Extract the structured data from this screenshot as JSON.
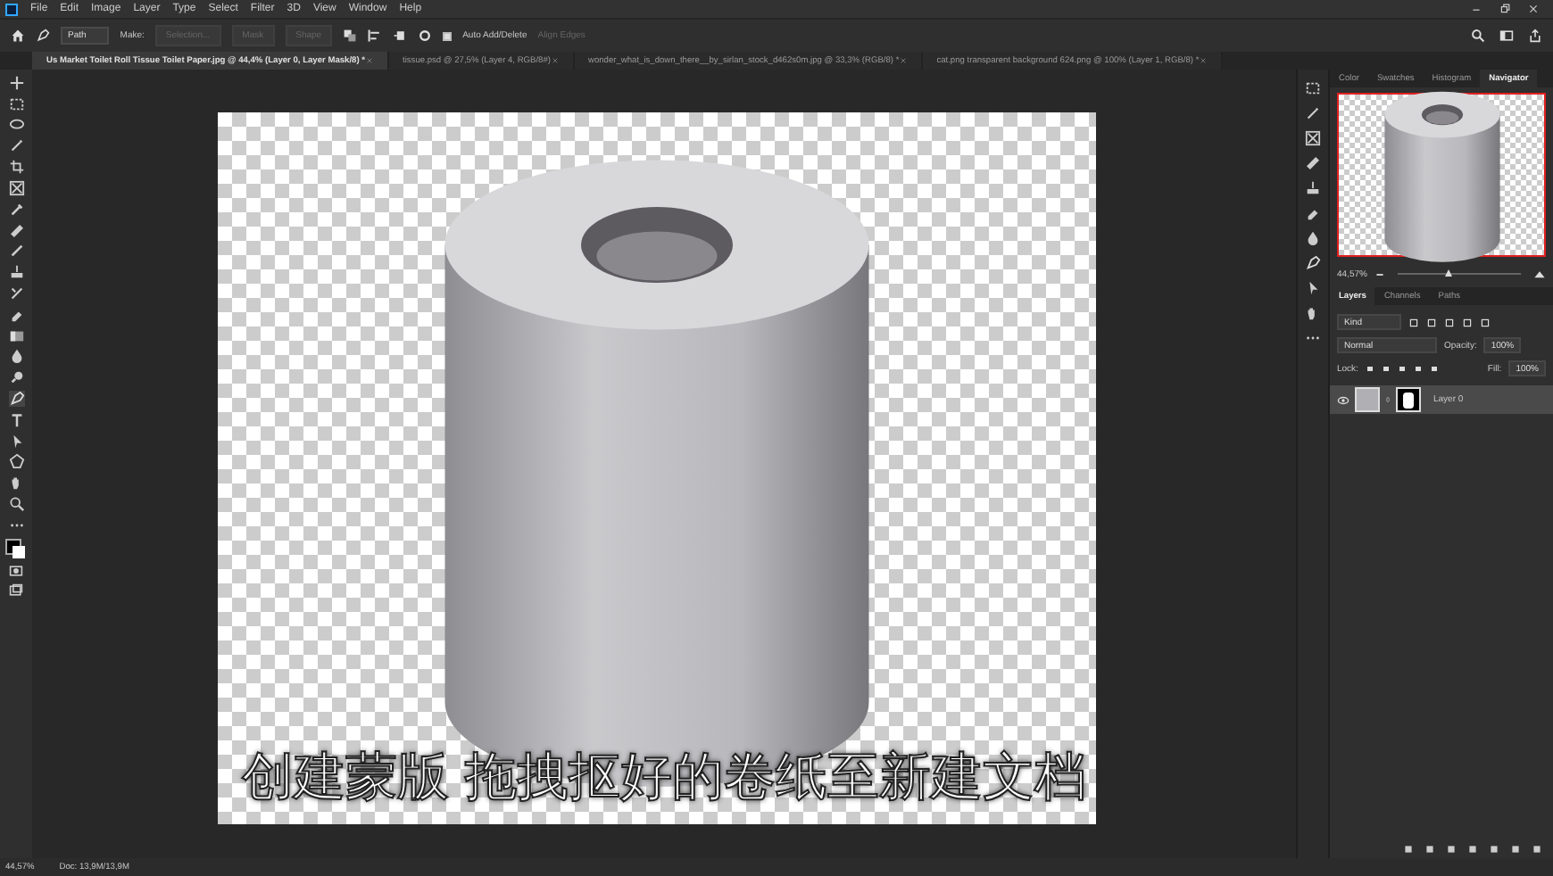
{
  "menu": [
    "File",
    "Edit",
    "Image",
    "Layer",
    "Type",
    "Select",
    "Filter",
    "3D",
    "View",
    "Window",
    "Help"
  ],
  "options_bar": {
    "mode": "Path",
    "make_label": "Make:",
    "buttons": [
      {
        "label": "Selection...",
        "disabled": true
      },
      {
        "label": "Mask",
        "disabled": true
      },
      {
        "label": "Shape",
        "disabled": true
      }
    ],
    "auto_add_delete": {
      "label": "Auto Add/Delete",
      "checked": true
    },
    "align_edges": {
      "label": "Align Edges",
      "disabled": true
    }
  },
  "document_tabs": [
    {
      "label": "Us Market Toilet Roll Tissue Toilet Paper.jpg @ 44,4% (Layer 0, Layer Mask/8) *",
      "selected": true
    },
    {
      "label": "tissue.psd @ 27,5% (Layer 4, RGB/8#)",
      "selected": false
    },
    {
      "label": "wonder_what_is_down_there__by_sirlan_stock_d462s0m.jpg @ 33,3% (RGB/8) *",
      "selected": false
    },
    {
      "label": "cat.png transparent background 624.png @ 100% (Layer 1, RGB/8) *",
      "selected": false
    }
  ],
  "subtitle": "创建蒙版 拖拽抠好的卷纸至新建文档",
  "navigator_panel": {
    "tabs": [
      {
        "label": "Color",
        "selected": false
      },
      {
        "label": "Swatches",
        "selected": false
      },
      {
        "label": "Histogram",
        "selected": false
      },
      {
        "label": "Navigator",
        "selected": true
      }
    ],
    "zoom": "44,57%",
    "level": 0.42
  },
  "layers_panel": {
    "tabs": [
      {
        "label": "Layers",
        "selected": true
      },
      {
        "label": "Channels",
        "selected": false
      },
      {
        "label": "Paths",
        "selected": false
      }
    ],
    "filter": "Kind",
    "blend_mode": "Normal",
    "opacity_label": "Opacity:",
    "opacity": "100%",
    "lock_label": "Lock:",
    "fill_label": "Fill:",
    "fill": "100%",
    "layers": [
      {
        "name": "Layer 0",
        "visible": true,
        "selected": true
      }
    ]
  },
  "status_bar": {
    "zoom": "44,57%",
    "doc": "Doc: 13,9M/13,9M"
  }
}
